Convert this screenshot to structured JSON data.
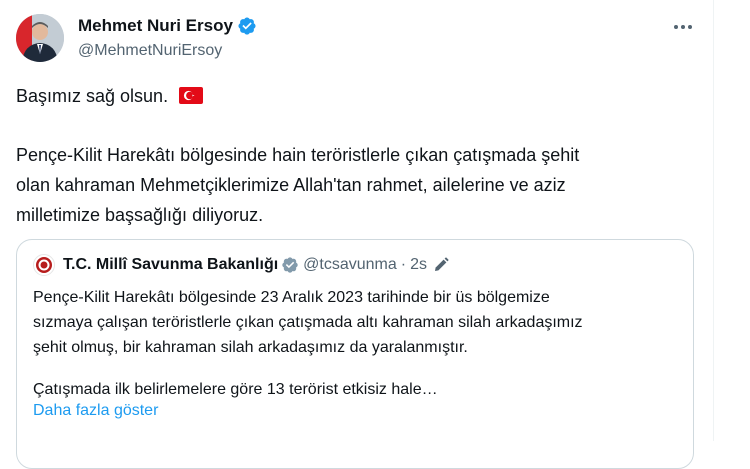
{
  "author": {
    "name": "Mehmet Nuri Ersoy",
    "handle": "@MehmetNuriErsoy"
  },
  "tweet": {
    "line1": "Başımız sağ olsun.",
    "paragraph_lines": [
      "Pençe-Kilit Harekâtı bölgesinde hain teröristlerle çıkan çatışmada şehit",
      "olan kahraman Mehmetçiklerimize Allah'tan rahmet, ailelerine ve aziz",
      "milletimize başsağlığı diliyoruz."
    ]
  },
  "quoted": {
    "name": "T.C. Millî Savunma Bakanlığı",
    "handle": "@tcsavunma",
    "separator": "·",
    "time": "2s",
    "lines": [
      "Pençe-Kilit Harekâtı bölgesinde 23 Aralık 2023 tarihinde bir üs bölgemize",
      "sızmaya çalışan teröristlerle çıkan çatışmada altı kahraman silah arkadaşımız",
      "şehit olmuş, bir kahraman silah arkadaşımız da yaralanmıştır."
    ],
    "truncated_line": "Çatışmada ilk belirlemelere göre 13 terörist etkisiz hale…",
    "show_more": "Daha fazla göster"
  },
  "icons": {
    "verified": "verified-badge-icon",
    "more": "more-horizontal-icon",
    "flag": "turkey-flag-icon",
    "edit": "edit-pencil-icon"
  },
  "colors": {
    "text": "#0f1419",
    "secondary": "#536471",
    "link": "#1d9bf0",
    "verified": "#1d9bf0",
    "border": "#cfd9de",
    "flag_red": "#e30a17"
  }
}
